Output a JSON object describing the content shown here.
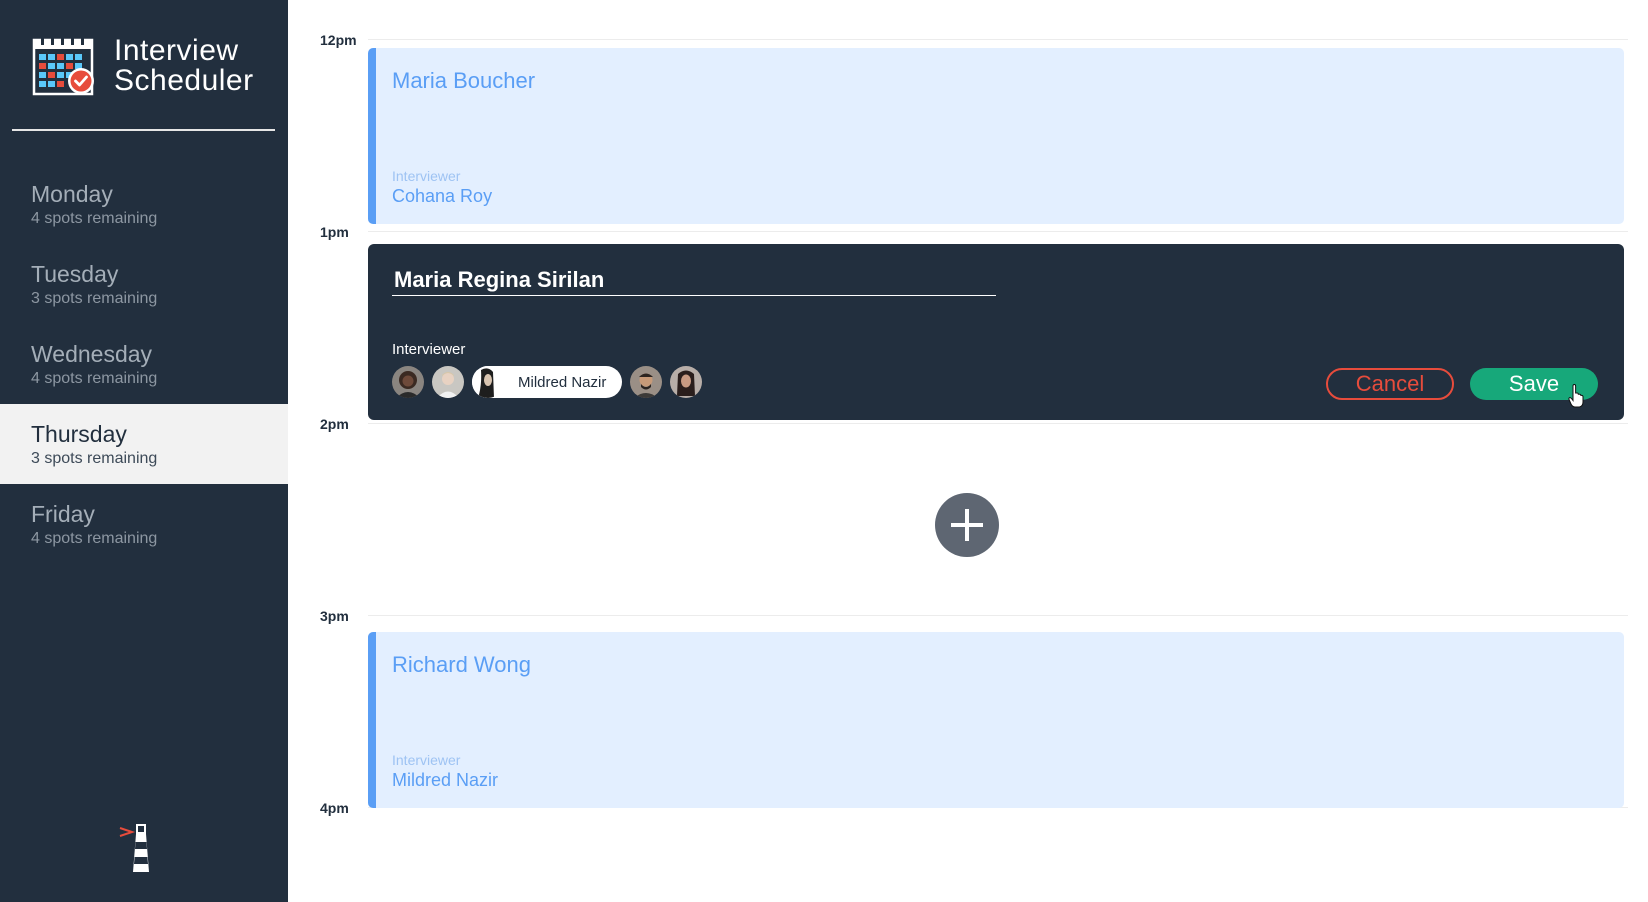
{
  "sidebar": {
    "brand": {
      "line1": "Interview",
      "line2": "Scheduler",
      "icon": "calendar-check-icon"
    },
    "days": [
      {
        "name": "Monday",
        "spots": "4 spots remaining",
        "selected": false
      },
      {
        "name": "Tuesday",
        "spots": "3 spots remaining",
        "selected": false
      },
      {
        "name": "Wednesday",
        "spots": "4 spots remaining",
        "selected": false
      },
      {
        "name": "Thursday",
        "spots": "3 spots remaining",
        "selected": true
      },
      {
        "name": "Friday",
        "spots": "4 spots remaining",
        "selected": false
      }
    ],
    "footer_icon": "lighthouse-icon"
  },
  "schedule": {
    "times": [
      "12pm",
      "1pm",
      "2pm",
      "3pm",
      "4pm"
    ],
    "appointments": [
      {
        "student": "Maria Boucher",
        "interviewer_label": "Interviewer",
        "interviewer": "Cohana Roy"
      },
      {
        "student": "Richard Wong",
        "interviewer_label": "Interviewer",
        "interviewer": "Mildred Nazir"
      }
    ],
    "form": {
      "student_value": "Maria Regina Sirilan",
      "interviewer_label": "Interviewer",
      "selected_interviewer": "Mildred Nazir",
      "cancel_label": "Cancel",
      "save_label": "Save"
    },
    "add_icon": "plus-icon"
  },
  "colors": {
    "sidebar_bg": "#222f3e",
    "appointment_bg": "#e3efff",
    "appointment_accent": "#5a9ef5",
    "cancel": "#e74c3c",
    "save": "#17a87a"
  }
}
